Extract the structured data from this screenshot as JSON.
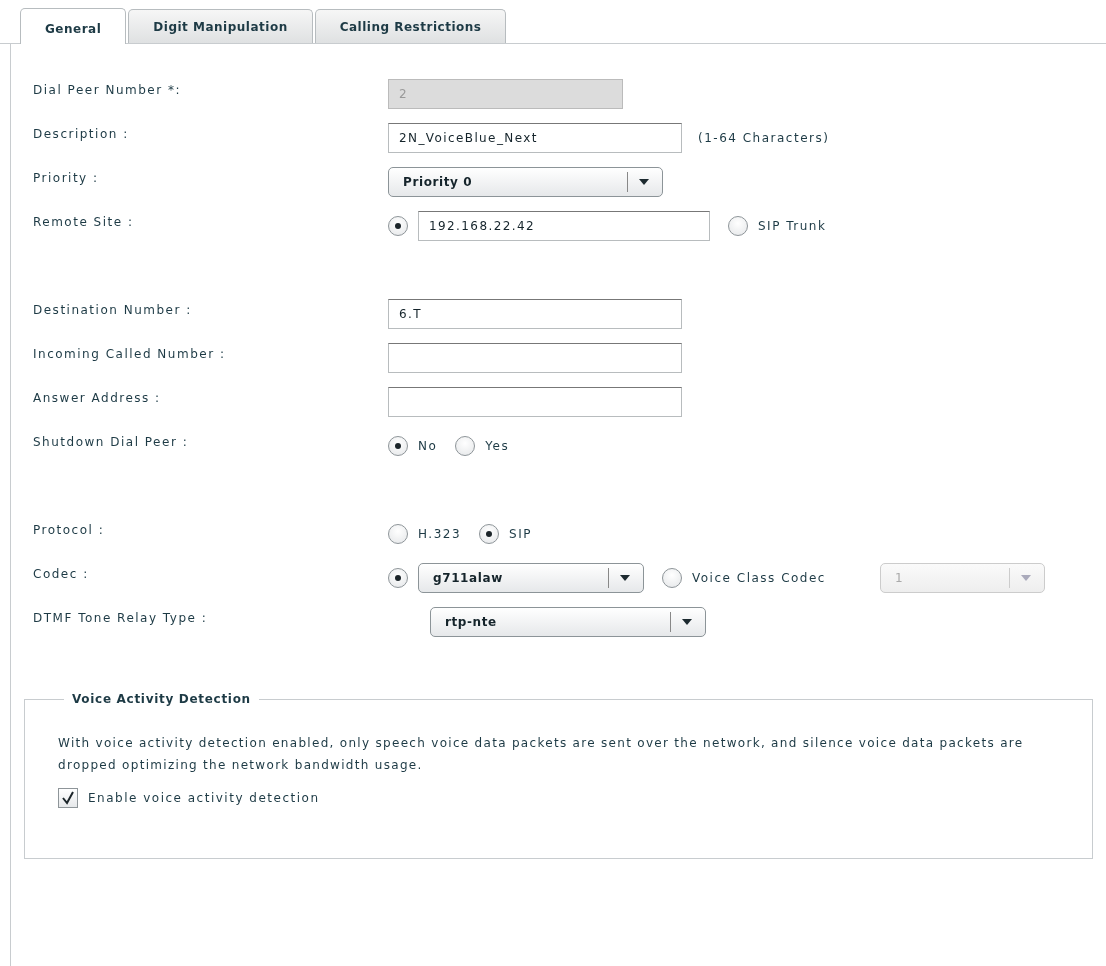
{
  "tabs": [
    {
      "label": "General",
      "selected": true
    },
    {
      "label": "Digit Manipulation",
      "selected": false
    },
    {
      "label": "Calling Restrictions",
      "selected": false
    }
  ],
  "groups": [
    {
      "fields": [
        {
          "kind": "input",
          "label": "Dial Peer Number *:",
          "value": "2",
          "disabled": true
        },
        {
          "kind": "input",
          "label": "Description :",
          "value": "2N_VoiceBlue_Next",
          "disabled": false,
          "hint": "(1-64 Characters)"
        },
        {
          "kind": "select",
          "label": "Priority :",
          "value": "Priority 0"
        },
        {
          "kind": "radios",
          "label": "Remote Site :",
          "options": [
            {
              "selected": true,
              "control": {
                "kind": "input",
                "value": "192.168.22.42"
              }
            },
            {
              "selected": false,
              "label": "SIP Trunk"
            }
          ]
        }
      ]
    },
    {
      "fields": [
        {
          "kind": "input",
          "label": "Destination Number :",
          "value": "6.T",
          "disabled": false
        },
        {
          "kind": "input",
          "label": "Incoming Called Number :",
          "disabled": false
        },
        {
          "kind": "input",
          "label": "Answer Address :",
          "disabled": false
        },
        {
          "kind": "radios",
          "label": "Shutdown Dial Peer :",
          "options": [
            {
              "selected": true,
              "label": "No"
            },
            {
              "selected": false,
              "label": "Yes"
            }
          ]
        }
      ]
    },
    {
      "fields": [
        {
          "kind": "radios",
          "label": "Protocol :",
          "options": [
            {
              "selected": false,
              "label": "H.323"
            },
            {
              "selected": true,
              "label": "SIP"
            }
          ]
        },
        {
          "kind": "radios",
          "label": "Codec :",
          "options": [
            {
              "selected": true,
              "control": {
                "kind": "select",
                "value": "g711alaw",
                "disabled": false
              }
            },
            {
              "selected": false,
              "label": "Voice Class Codec",
              "control": {
                "kind": "select",
                "value": "1",
                "disabled": true
              }
            }
          ]
        },
        {
          "kind": "aligned-select",
          "label": "DTMF Tone Relay Type :",
          "value": "rtp-nte"
        }
      ]
    }
  ],
  "vad": {
    "legend": "Voice Activity Detection",
    "text": "With voice activity detection enabled, only speech voice data packets are sent over the network, and silence voice data packets are dropped optimizing the network bandwidth usage.",
    "checkbox": {
      "label": "Enable voice activity detection",
      "checked": true
    }
  }
}
